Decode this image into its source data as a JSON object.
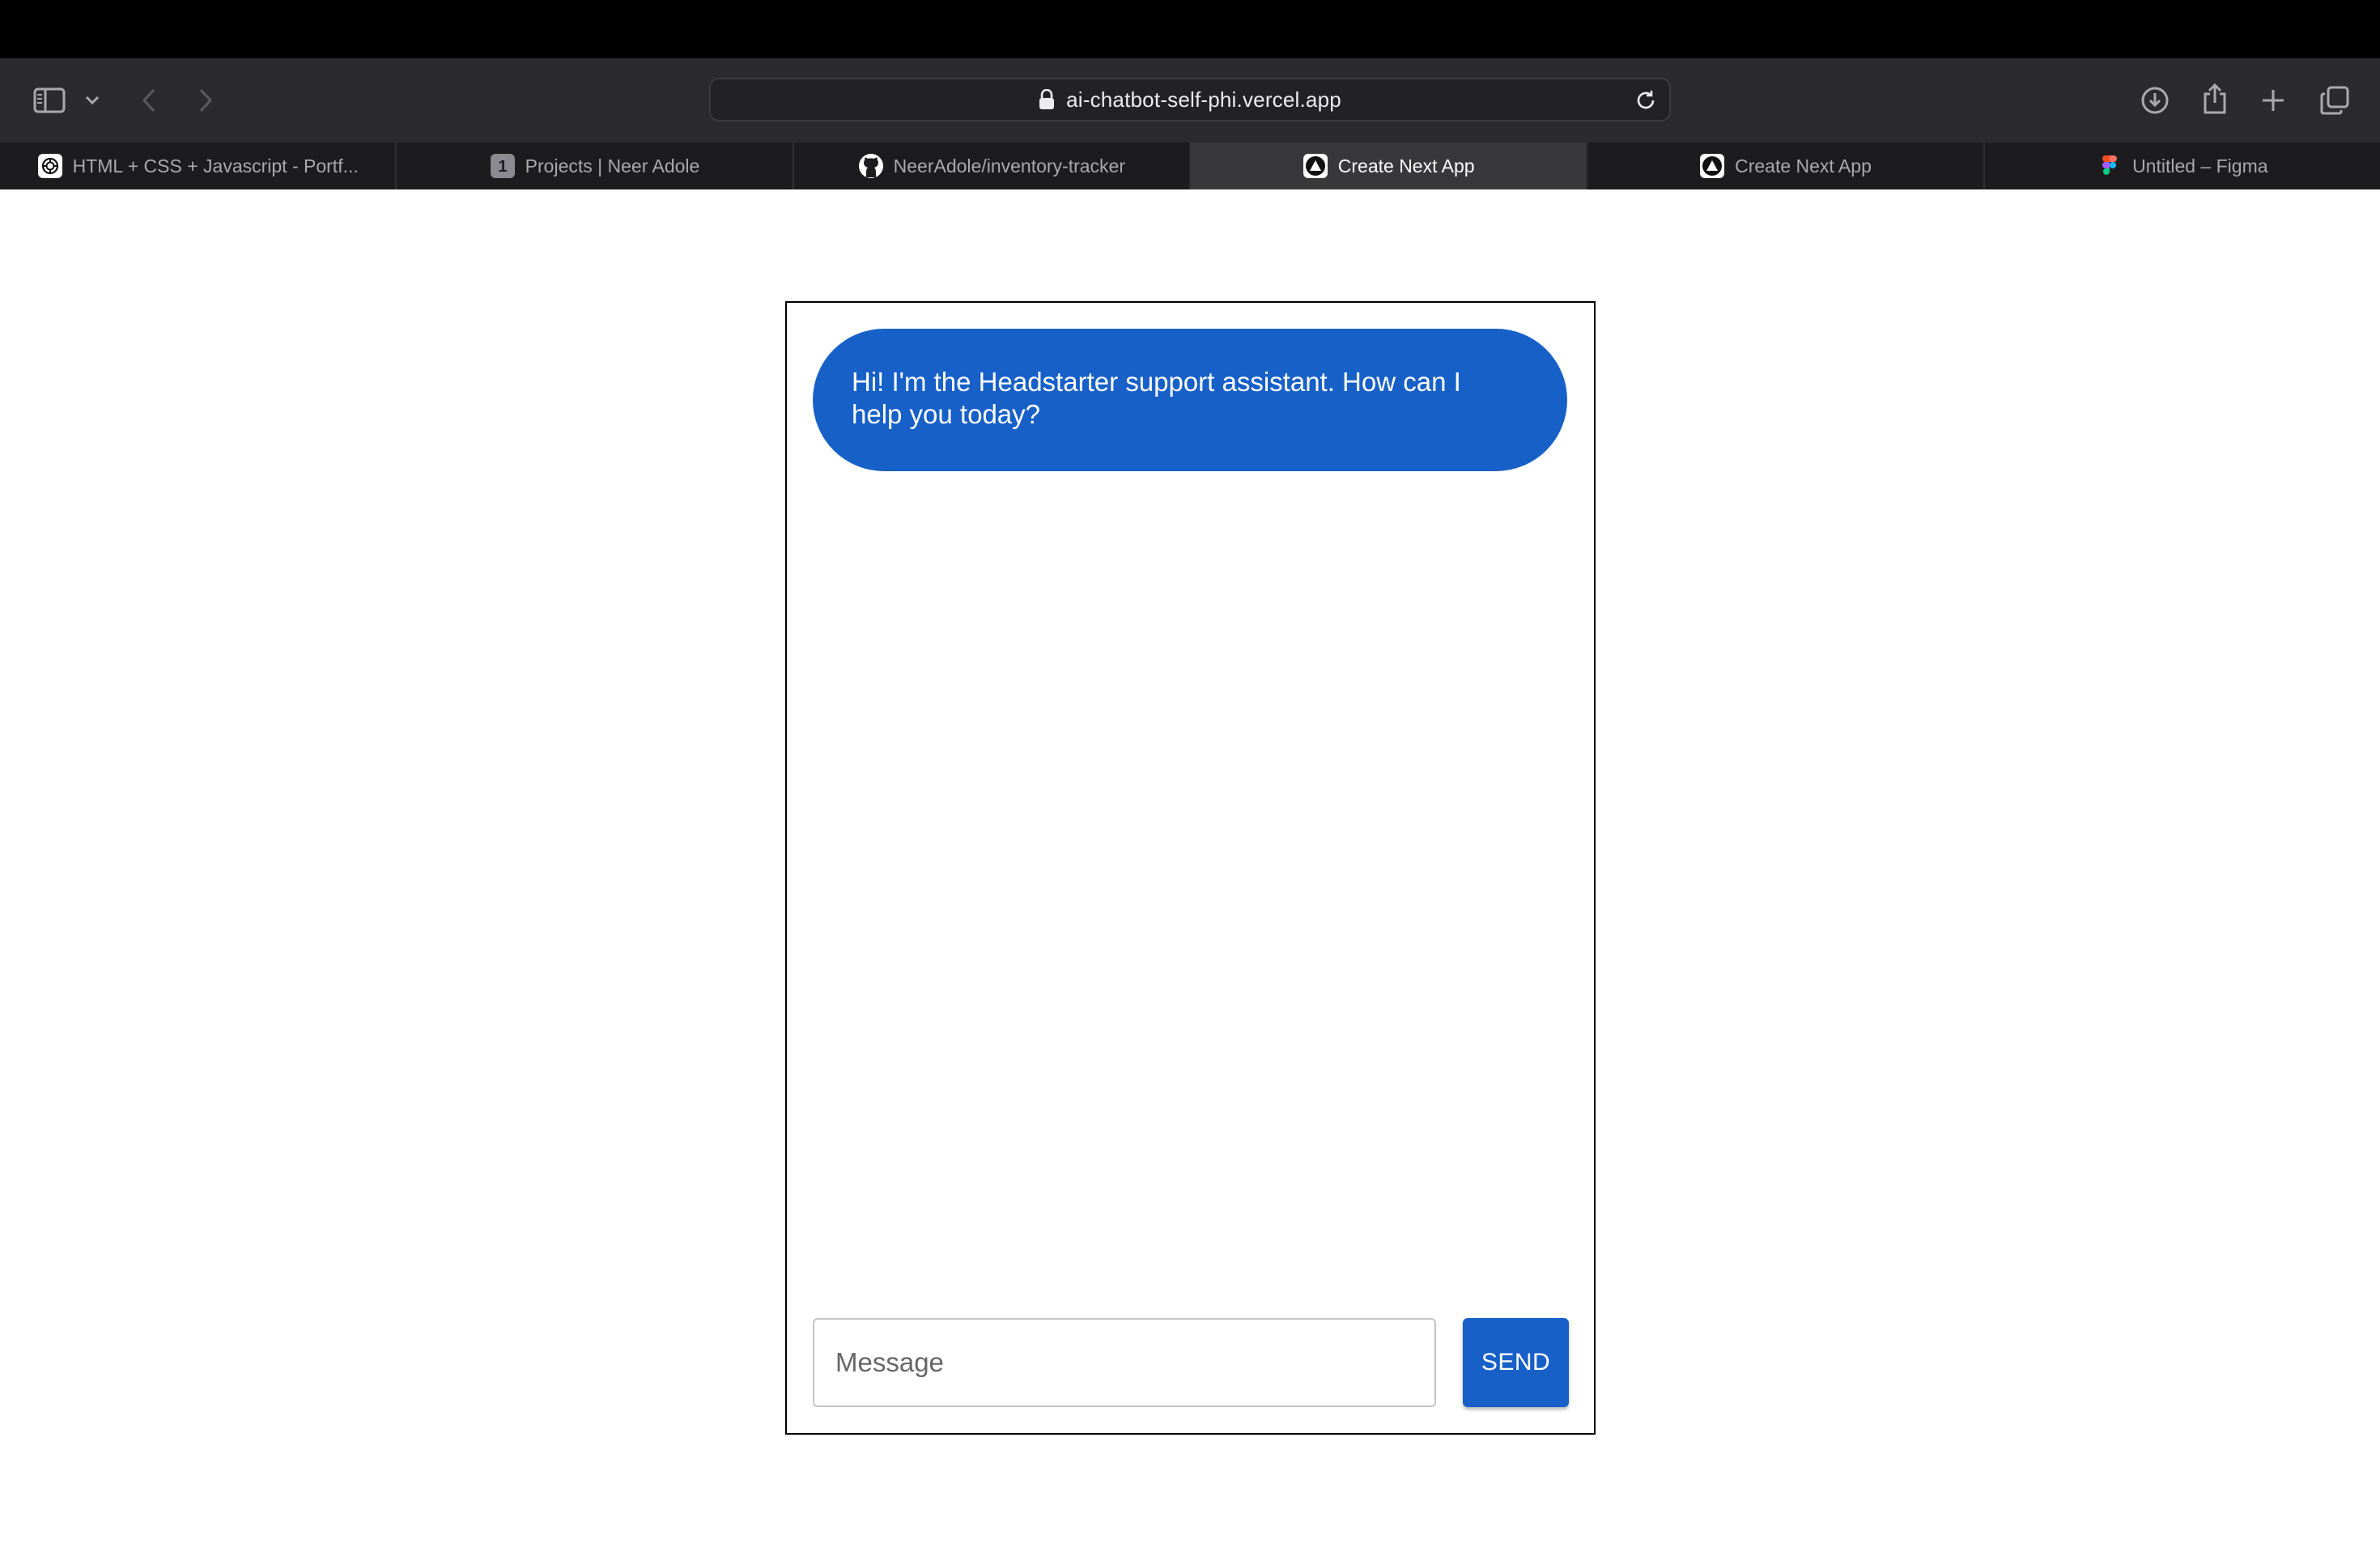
{
  "browser": {
    "url": "ai-chatbot-self-phi.vercel.app",
    "tabs": [
      {
        "label": "HTML + CSS + Javascript - Portf...",
        "icon": "openai-icon",
        "active": false
      },
      {
        "label": "Projects | Neer Adole",
        "icon": "number-one-badge-icon",
        "badge": "1",
        "active": false
      },
      {
        "label": "NeerAdole/inventory-tracker",
        "icon": "github-icon",
        "active": false
      },
      {
        "label": "Create Next App",
        "icon": "vercel-triangle-icon",
        "active": true
      },
      {
        "label": "Create Next App",
        "icon": "vercel-triangle-icon",
        "active": false
      },
      {
        "label": "Untitled – Figma",
        "icon": "figma-icon",
        "active": false
      }
    ]
  },
  "chat": {
    "messages": [
      {
        "role": "assistant",
        "text": "Hi! I'm the Headstarter support assistant. How can I help you today?"
      }
    ],
    "input": {
      "placeholder": "Message",
      "value": ""
    },
    "send_label": "SEND"
  },
  "colors": {
    "accent": "#1760c8",
    "toolbar": "#2b2b2e",
    "tabbar": "#1c1c1e",
    "active_tab": "#38383b"
  }
}
